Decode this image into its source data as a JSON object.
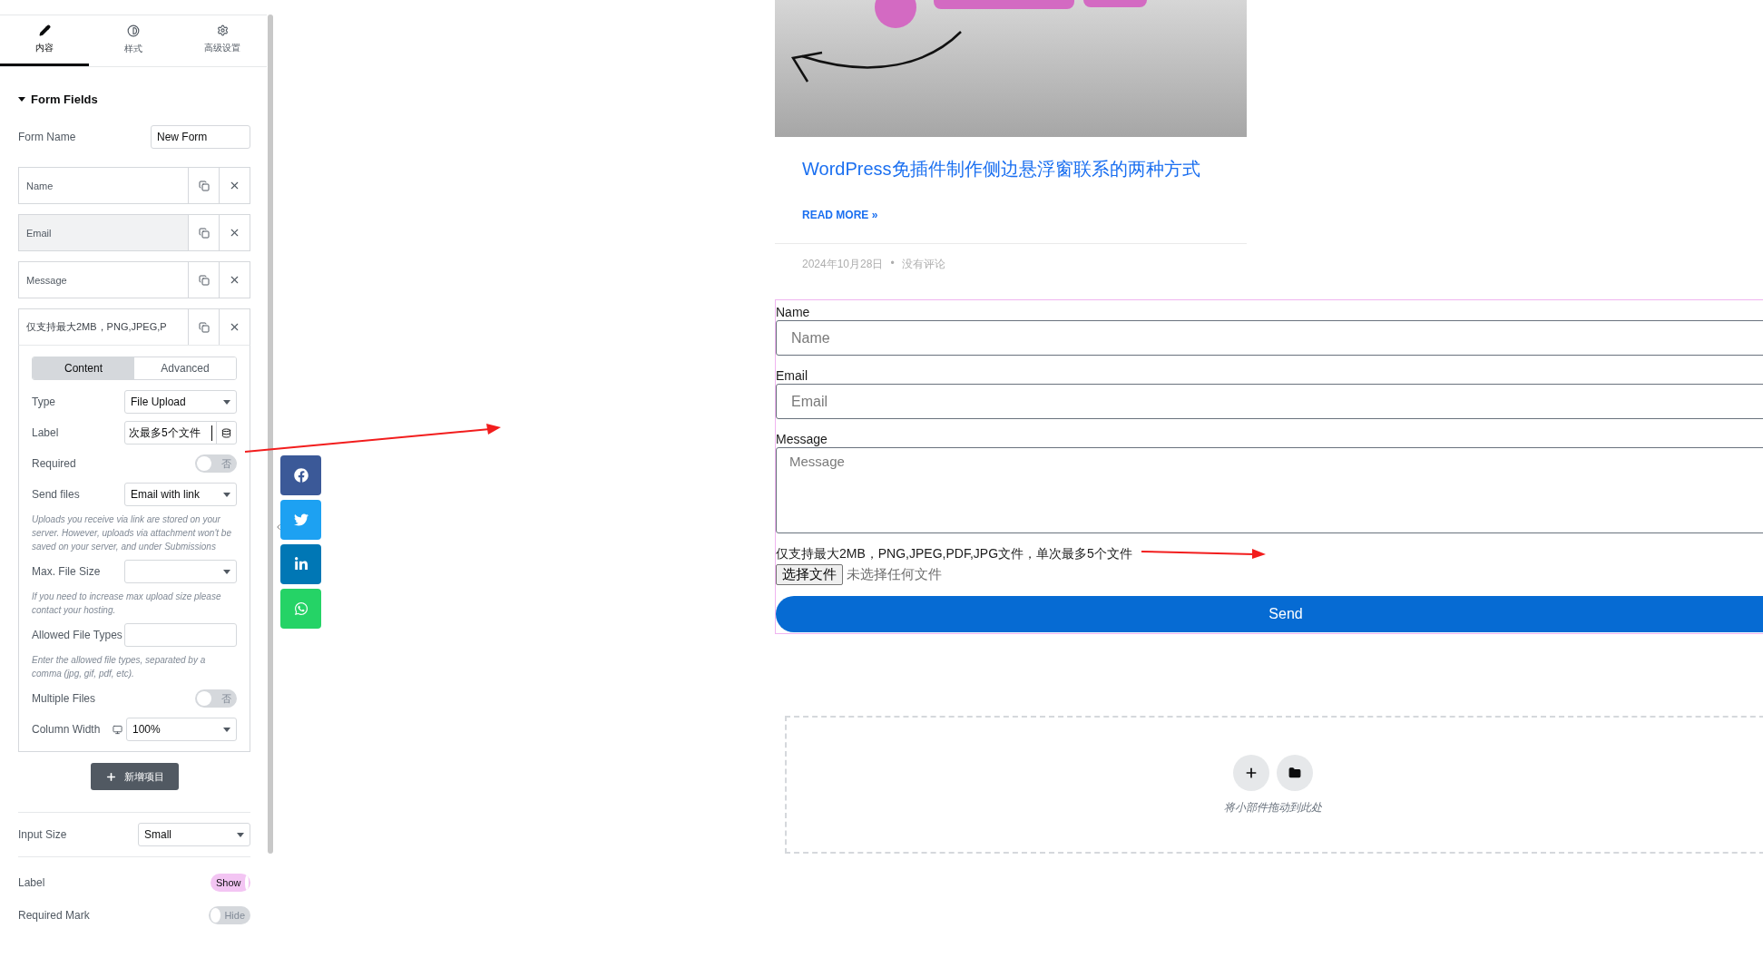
{
  "editor_panel": {
    "tabs": [
      {
        "kind": "pencil",
        "label": "内容",
        "selected": true
      },
      {
        "kind": "contrast",
        "label": "样式",
        "selected": false
      },
      {
        "kind": "gear",
        "label": "高级设置",
        "selected": false
      }
    ],
    "section": {
      "title": "Form Fields",
      "expanded": true
    },
    "form_name": {
      "label": "Form Name",
      "value": "New Form"
    },
    "items": [
      {
        "label": "Name",
        "highlighted": false,
        "expanded": false
      },
      {
        "label": "Email",
        "highlighted": true,
        "expanded": false
      },
      {
        "label": "Message",
        "highlighted": false,
        "expanded": false
      },
      {
        "label": "仅支持最大2MB，PNG,JPEG,P",
        "highlighted": false,
        "expanded": true
      }
    ],
    "item_editor": {
      "tabs": [
        {
          "label": "Content",
          "selected": true
        },
        {
          "label": "Advanced",
          "selected": false
        }
      ],
      "controls": [
        {
          "kind": "select",
          "label": "Type",
          "value": "File Upload"
        },
        {
          "kind": "dynamic",
          "label": "Label",
          "value": "次最多5个文件"
        },
        {
          "kind": "toggle",
          "label": "Required",
          "on": false,
          "text": "否"
        },
        {
          "kind": "select",
          "label": "Send files",
          "value": "Email with link"
        },
        {
          "kind": "note",
          "text": "Uploads you receive via link are stored on your server. However, uploads via attachment won't be saved on your server, and under Submissions"
        },
        {
          "kind": "select",
          "label": "Max. File Size"
        },
        {
          "kind": "note",
          "text": "If you need to increase max upload size please contact your hosting."
        },
        {
          "kind": "text",
          "label": "Allowed File Types"
        },
        {
          "kind": "note",
          "text": "Enter the allowed file types, separated by a comma (jpg, gif, pdf, etc)."
        },
        {
          "kind": "toggle",
          "label": "Multiple Files",
          "on": false,
          "text": "否"
        },
        {
          "kind": "responsive",
          "label": "Column Width",
          "value": "100%"
        }
      ]
    },
    "add_button": "新增项目",
    "settings": [
      {
        "kind": "select",
        "label": "Input Size",
        "value": "Small"
      },
      {
        "kind": "toggle",
        "label": "Label",
        "on": true,
        "text": "Show"
      },
      {
        "kind": "toggle",
        "label": "Required Mark",
        "on": false,
        "text": "Hide"
      }
    ]
  },
  "share_buttons": [
    {
      "kind": "facebook",
      "color": "#3b5998"
    },
    {
      "kind": "twitter",
      "color": "#1da1f2"
    },
    {
      "kind": "linkedin",
      "color": "#0077b5"
    },
    {
      "kind": "whatsapp",
      "color": "#25d366"
    }
  ],
  "post": {
    "title": "WordPress免插件制作侧边悬浮窗联系的两种方式",
    "read_more": "READ MORE »",
    "date": "2024年10月28日",
    "separator": "•",
    "comments": "没有评论"
  },
  "form": {
    "selected": true,
    "fields": [
      {
        "kind": "input",
        "label": "Name",
        "placeholder": "Name"
      },
      {
        "kind": "input",
        "label": "Email",
        "placeholder": "Email"
      },
      {
        "kind": "textarea",
        "label": "Message",
        "placeholder": "Message"
      }
    ],
    "file": {
      "label": "仅支持最大2MB，PNG,JPEG,PDF,JPG文件，单次最多5个文件",
      "button": "选择文件",
      "status": "未选择任何文件"
    },
    "submit": "Send"
  },
  "dropzone": {
    "hint": "将小部件拖动到此处"
  }
}
